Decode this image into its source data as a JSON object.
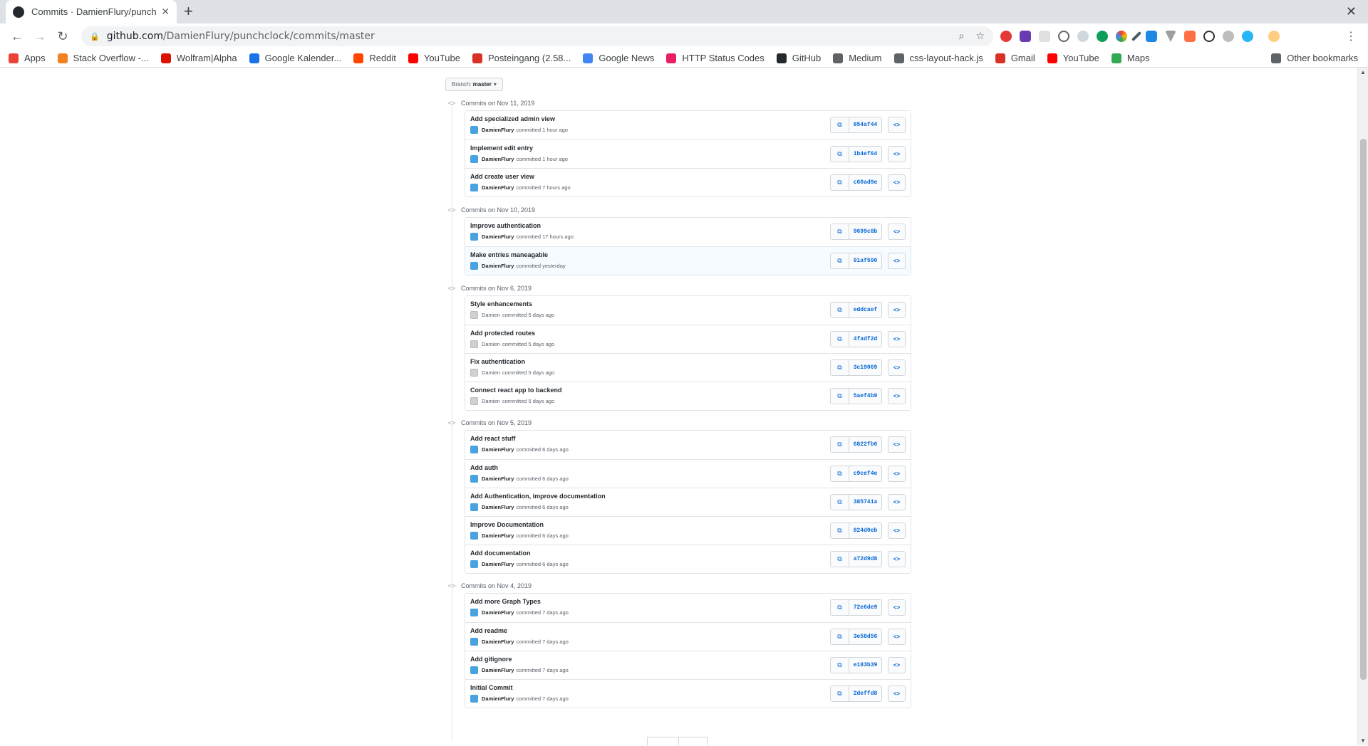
{
  "browser": {
    "tab_title": "Commits · DamienFlury/punchclock",
    "url_host": "github.com",
    "url_path": "/DamienFlury/punchclock/commits/master"
  },
  "bookmarks": [
    {
      "label": "Apps",
      "color": "#ea4335"
    },
    {
      "label": "Stack Overflow -...",
      "color": "#f48024"
    },
    {
      "label": "Wolfram|Alpha",
      "color": "#dd1100"
    },
    {
      "label": "Google Kalender...",
      "color": "#1a73e8"
    },
    {
      "label": "Reddit",
      "color": "#ff4500"
    },
    {
      "label": "YouTube",
      "color": "#ff0000"
    },
    {
      "label": "Posteingang (2.58...",
      "color": "#d93025"
    },
    {
      "label": "Google News",
      "color": "#4285f4"
    },
    {
      "label": "HTTP Status Codes",
      "color": "#e91e63"
    },
    {
      "label": "GitHub",
      "color": "#24292e"
    },
    {
      "label": "Medium",
      "color": "#5f6368"
    },
    {
      "label": "css-layout-hack.js",
      "color": "#5f6368"
    },
    {
      "label": "Gmail",
      "color": "#d93025"
    },
    {
      "label": "YouTube",
      "color": "#ff0000"
    },
    {
      "label": "Maps",
      "color": "#34a853"
    }
  ],
  "other_bookmarks": "Other bookmarks",
  "branch": {
    "prefix": "Branch:",
    "name": "master"
  },
  "groups": [
    {
      "date": "Commits on Nov 11, 2019",
      "commits": [
        {
          "msg": "Add specialized admin view",
          "author": "DamienFlury",
          "time": "committed 1 hour ago",
          "sha": "854af44"
        },
        {
          "msg": "Implement edit entry",
          "author": "DamienFlury",
          "time": "committed 1 hour ago",
          "sha": "1b4ef64"
        },
        {
          "msg": "Add create user view",
          "author": "DamienFlury",
          "time": "committed 7 hours ago",
          "sha": "c60ad9e"
        }
      ]
    },
    {
      "date": "Commits on Nov 10, 2019",
      "commits": [
        {
          "msg": "Improve authentication",
          "author": "DamienFlury",
          "time": "committed 17 hours ago",
          "sha": "9699c8b"
        },
        {
          "msg": "Make entries maneagable",
          "author": "DamienFlury",
          "time": "committed yesterday",
          "sha": "91af590"
        }
      ]
    },
    {
      "date": "Commits on Nov 6, 2019",
      "commits": [
        {
          "msg": "Style enhancements",
          "author": "Damien",
          "time": "committed 5 days ago",
          "sha": "eddcaef"
        },
        {
          "msg": "Add protected routes",
          "author": "Damien",
          "time": "committed 5 days ago",
          "sha": "4fadf2d"
        },
        {
          "msg": "Fix authentication",
          "author": "Damien",
          "time": "committed 5 days ago",
          "sha": "3c19069"
        },
        {
          "msg": "Connect react app to backend",
          "author": "Damien",
          "time": "committed 5 days ago",
          "sha": "5aef4b9"
        }
      ]
    },
    {
      "date": "Commits on Nov 5, 2019",
      "commits": [
        {
          "msg": "Add react stuff",
          "author": "DamienFlury",
          "time": "committed 6 days ago",
          "sha": "6822fb6"
        },
        {
          "msg": "Add auth",
          "author": "DamienFlury",
          "time": "committed 6 days ago",
          "sha": "c9cef4e"
        },
        {
          "msg": "Add Authentication, improve documentation",
          "author": "DamienFlury",
          "time": "committed 6 days ago",
          "sha": "385741a"
        },
        {
          "msg": "Improve Documentation",
          "author": "DamienFlury",
          "time": "committed 6 days ago",
          "sha": "824d0eb"
        },
        {
          "msg": "Add documentation",
          "author": "DamienFlury",
          "time": "committed 6 days ago",
          "sha": "a72d9d8"
        }
      ]
    },
    {
      "date": "Commits on Nov 4, 2019",
      "commits": [
        {
          "msg": "Add more Graph Types",
          "author": "DamienFlury",
          "time": "committed 7 days ago",
          "sha": "72e6de9"
        },
        {
          "msg": "Add readme",
          "author": "DamienFlury",
          "time": "committed 7 days ago",
          "sha": "3e58d56"
        },
        {
          "msg": "Add gitignore",
          "author": "DamienFlury",
          "time": "committed 7 days ago",
          "sha": "e183b39"
        },
        {
          "msg": "Initial Commit",
          "author": "DamienFlury",
          "time": "committed 7 days ago",
          "sha": "2deffd8"
        }
      ]
    }
  ]
}
